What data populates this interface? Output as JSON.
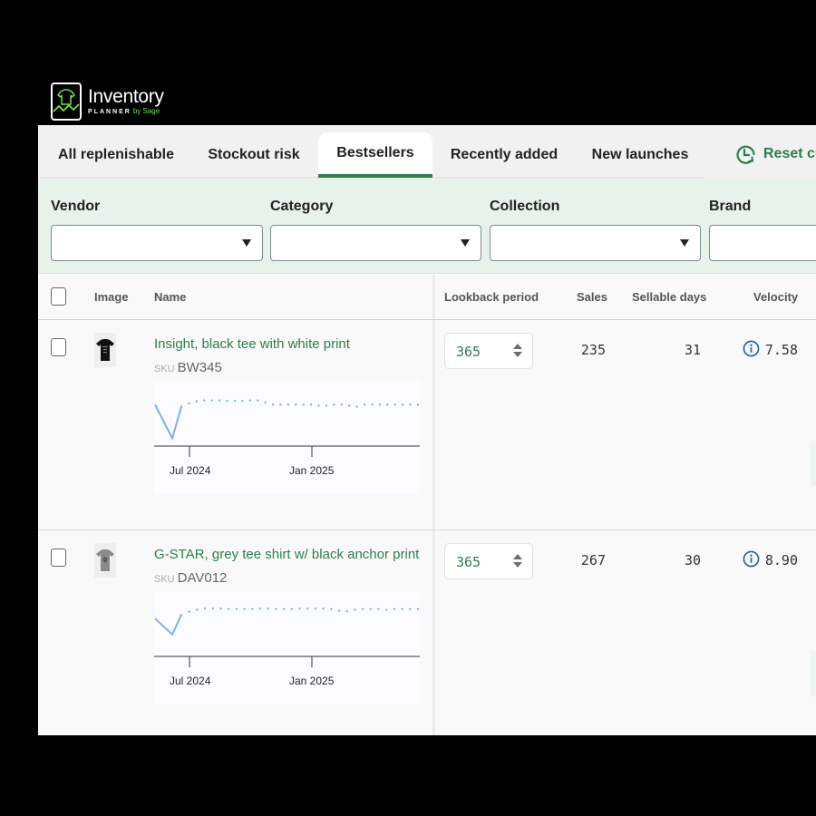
{
  "logo": {
    "title": "Inventory",
    "subtitle": "PLANNER",
    "by": "by Sage"
  },
  "tabs": [
    {
      "label": "All replenishable",
      "active": false
    },
    {
      "label": "Stockout risk",
      "active": false
    },
    {
      "label": "Bestsellers",
      "active": true
    },
    {
      "label": "Recently added",
      "active": false
    },
    {
      "label": "New launches",
      "active": false
    }
  ],
  "reset_label": "Reset cu",
  "filters": [
    {
      "label": "Vendor",
      "value": ""
    },
    {
      "label": "Category",
      "value": ""
    },
    {
      "label": "Collection",
      "value": ""
    },
    {
      "label": "Brand",
      "value": ""
    }
  ],
  "columns": {
    "image": "Image",
    "name": "Name",
    "lookback": "Lookback period",
    "sales": "Sales",
    "sellable_days": "Sellable days",
    "velocity": "Velocity"
  },
  "colors": {
    "accent": "#2e7d4a",
    "info": "#1e5fa8",
    "spark": "#7fb2e5"
  },
  "rows": [
    {
      "name": "Insight, black tee with white print",
      "sku_label": "SKU",
      "sku": "BW345",
      "thumb": "black-tee",
      "lookback": "365",
      "sales": "235",
      "sellable_days": "31",
      "velocity": "7.58",
      "sparkline": {
        "x_ticks": [
          "Jul 2024",
          "Jan 2025"
        ],
        "solid": [
          0.72,
          0.08,
          0.68
        ],
        "dotted": [
          0.68,
          0.74,
          0.78,
          0.8,
          0.8,
          0.8,
          0.79,
          0.79,
          0.79,
          0.8,
          0.8,
          0.76,
          0.72,
          0.72,
          0.72,
          0.72,
          0.72,
          0.72,
          0.7,
          0.7,
          0.72,
          0.72,
          0.7,
          0.68,
          0.72,
          0.72,
          0.72,
          0.72,
          0.72,
          0.72,
          0.72,
          0.72
        ]
      }
    },
    {
      "name": "G-STAR, grey tee shirt w/ black anchor print",
      "sku_label": "SKU",
      "sku": "DAV012",
      "thumb": "grey-tee",
      "lookback": "365",
      "sales": "267",
      "sellable_days": "30",
      "velocity": "8.90",
      "sparkline": {
        "x_ticks": [
          "Jul 2024",
          "Jan 2025"
        ],
        "solid": [
          0.65,
          0.35,
          0.72
        ],
        "dotted": [
          0.72,
          0.78,
          0.82,
          0.84,
          0.84,
          0.84,
          0.83,
          0.83,
          0.83,
          0.83,
          0.84,
          0.84,
          0.83,
          0.83,
          0.83,
          0.84,
          0.84,
          0.84,
          0.84,
          0.83,
          0.8,
          0.79,
          0.82,
          0.83,
          0.83,
          0.83,
          0.82,
          0.83,
          0.83,
          0.83,
          0.83
        ]
      }
    }
  ]
}
